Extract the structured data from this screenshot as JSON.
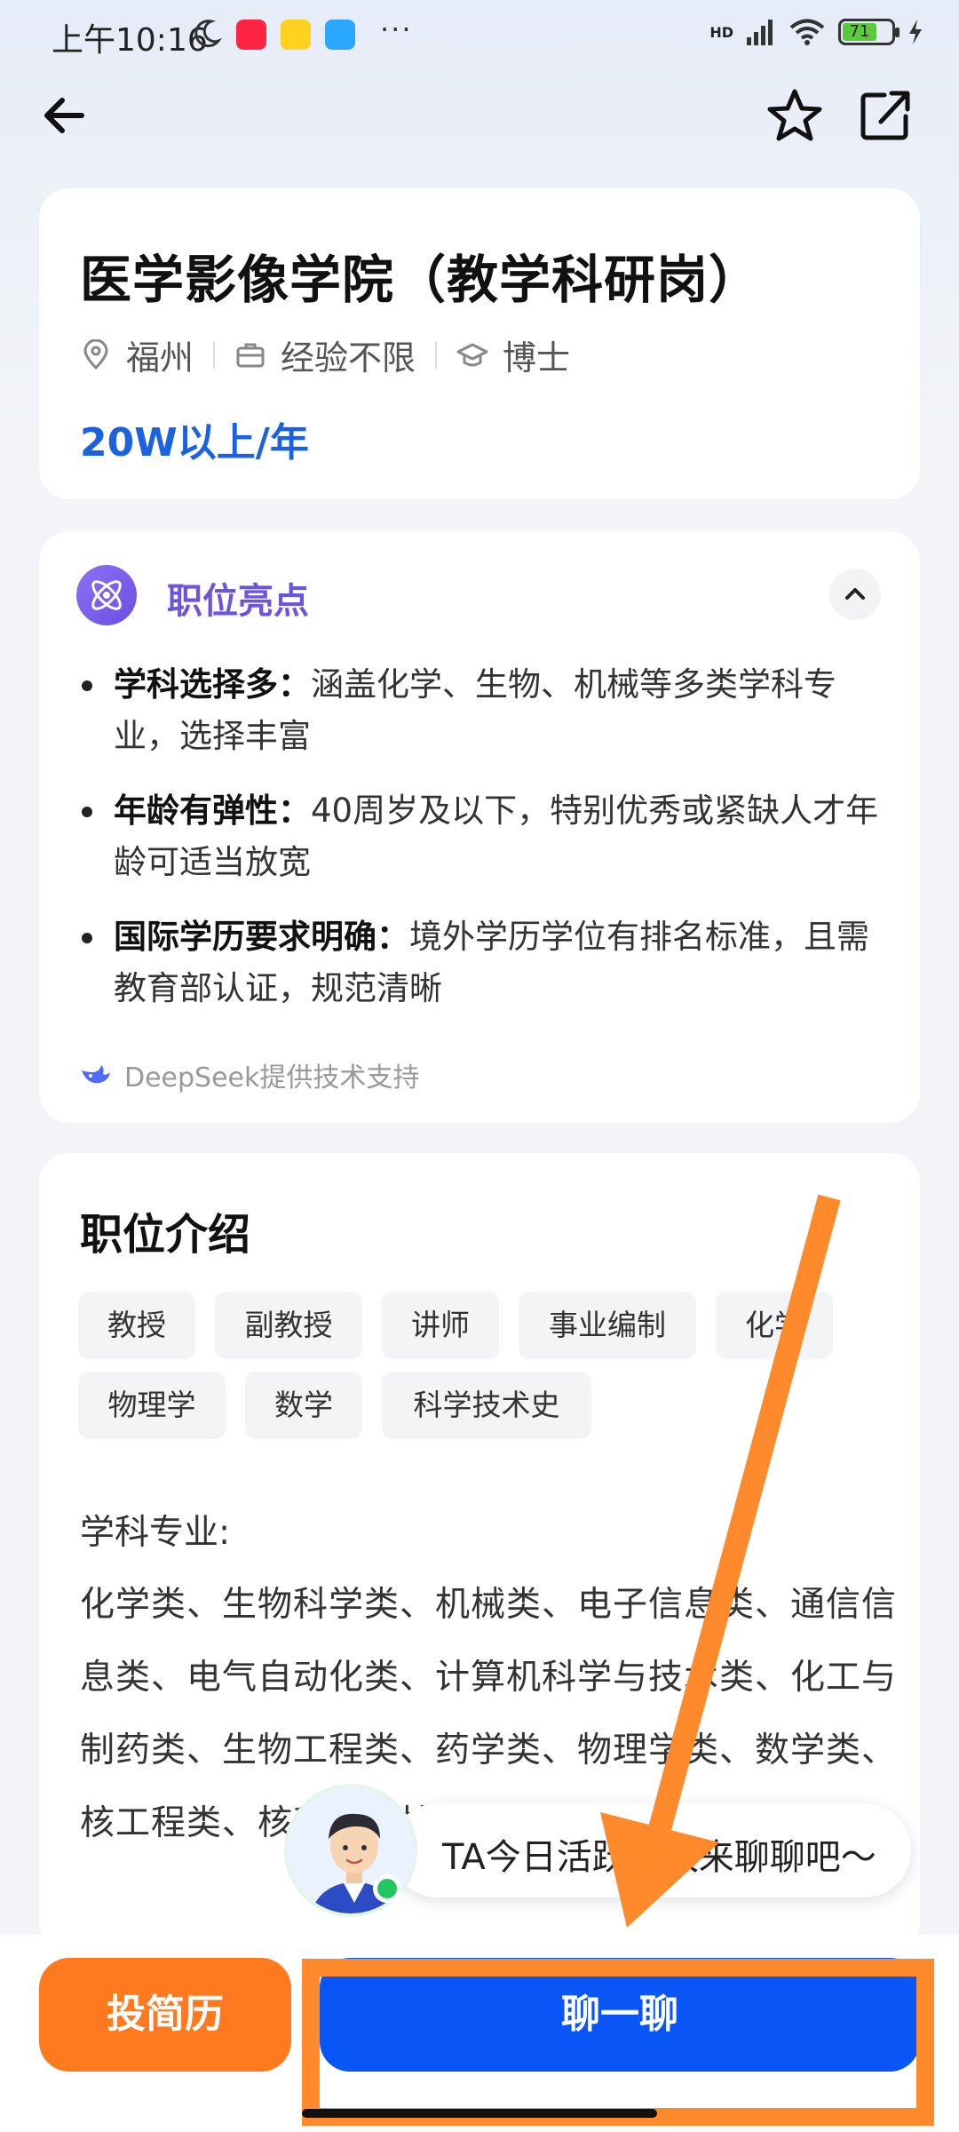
{
  "status_bar": {
    "time": "上午10:16",
    "battery": "71",
    "network": "HD"
  },
  "nav": {
    "back_icon": "back-arrow-icon",
    "favorite_icon": "star-icon",
    "share_icon": "share-icon"
  },
  "job": {
    "title": "医学影像学院（教学科研岗）",
    "location": "福州",
    "experience": "经验不限",
    "education": "博士",
    "salary": "20W以上/年"
  },
  "highlights": {
    "title": "职位亮点",
    "items": [
      {
        "label": "学科选择多：",
        "text": "涵盖化学、生物、机械等多类学科专业，选择丰富"
      },
      {
        "label": "年龄有弹性：",
        "text": "40周岁及以下，特别优秀或紧缺人才年龄可适当放宽"
      },
      {
        "label": "国际学历要求明确：",
        "text": "境外学历学位有排名标准，且需教育部认证，规范清晰"
      }
    ],
    "powered_by": "DeepSeek提供技术支持"
  },
  "intro": {
    "title": "职位介绍",
    "tags": [
      "教授",
      "副教授",
      "讲师",
      "事业编制",
      "化学",
      "物理学",
      "数学",
      "科学技术史"
    ],
    "subject_label": "学科专业:",
    "subject_text": "化学类、生物科学类、机械类、电子信息类、通信信息类、电气自动化类、计算机科学与技术类、化工与制药类、生物工程类、药学类、物理学类、数学类、核工程类、核科学与技术类"
  },
  "chat_bubble": {
    "text": "TA今日活跃，快来聊聊吧～"
  },
  "bottom": {
    "resume_label": "投简历",
    "chat_label": "聊一聊"
  },
  "colors": {
    "accent_blue": "#0a55f5",
    "accent_orange": "#ff7a1f",
    "salary_blue": "#1b62e0",
    "highlight_purple": "#6d54dc",
    "annotation_orange": "#ff8a2c"
  }
}
